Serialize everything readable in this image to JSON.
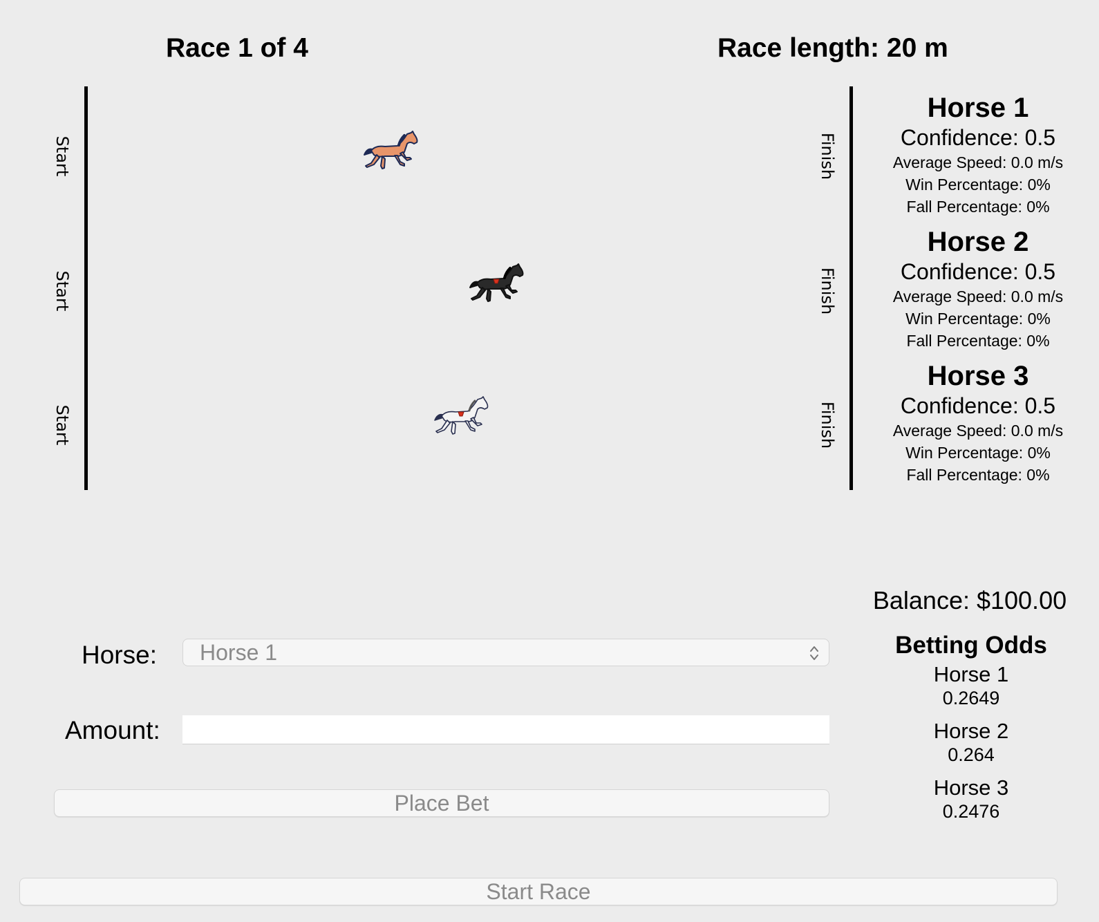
{
  "header": {
    "race_title": "Race 1 of 4",
    "race_length": "Race length: 20 m"
  },
  "track": {
    "start_label": "Start",
    "finish_label": "Finish",
    "lanes": [
      {
        "horse": "Horse 1",
        "coat_color": "#e8956a",
        "progress": 0.39
      },
      {
        "horse": "Horse 2",
        "coat_color": "#2a2a2a",
        "progress": 0.54
      },
      {
        "horse": "Horse 3",
        "coat_color": "#f4f4f4",
        "progress": 0.49
      }
    ]
  },
  "horses": [
    {
      "name": "Horse 1",
      "confidence": "Confidence: 0.5",
      "avg_speed": "Average Speed: 0.0 m/s",
      "win_pct": "Win Percentage: 0%",
      "fall_pct": "Fall Percentage: 0%"
    },
    {
      "name": "Horse 2",
      "confidence": "Confidence: 0.5",
      "avg_speed": "Average Speed: 0.0 m/s",
      "win_pct": "Win Percentage: 0%",
      "fall_pct": "Fall Percentage: 0%"
    },
    {
      "name": "Horse 3",
      "confidence": "Confidence: 0.5",
      "avg_speed": "Average Speed: 0.0 m/s",
      "win_pct": "Win Percentage: 0%",
      "fall_pct": "Fall Percentage: 0%"
    }
  ],
  "balance": "Balance: $100.00",
  "odds": {
    "title": "Betting Odds",
    "items": [
      {
        "name": "Horse 1",
        "value": "0.2649"
      },
      {
        "name": "Horse 2",
        "value": "0.264"
      },
      {
        "name": "Horse 3",
        "value": "0.2476"
      }
    ]
  },
  "bet_form": {
    "horse_label": "Horse:",
    "horse_selected": "Horse 1",
    "amount_label": "Amount:",
    "amount_value": "",
    "place_bet_label": "Place Bet"
  },
  "start_race_label": "Start Race",
  "icons": {
    "horse": "horse-icon",
    "select_chevron": "chevron-updown-icon"
  }
}
